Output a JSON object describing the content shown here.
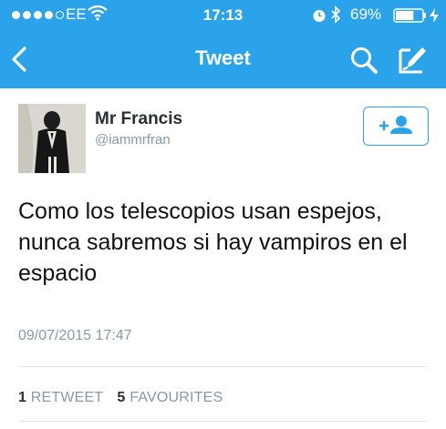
{
  "status_bar": {
    "carrier": "EE",
    "time": "17:13",
    "battery": "69%",
    "battery_level": 0.69
  },
  "nav": {
    "title": "Tweet",
    "icons": [
      "back-chevron-icon",
      "search-icon",
      "compose-icon"
    ]
  },
  "tweet": {
    "author_name": "Mr Francis",
    "author_handle": "@iammrfran",
    "text": "Como los telescopios usan espejos, nunca sabremos si hay vampiros en el espacio",
    "timestamp": "09/07/2015 17:47",
    "retweets_count": "1",
    "retweets_label": "RETWEET",
    "favourites_count": "5",
    "favourites_label": "FAVOURITES"
  },
  "colors": {
    "header": "#2ba3ea",
    "accent": "#2ba3ea",
    "muted_text": "#8899a6"
  }
}
